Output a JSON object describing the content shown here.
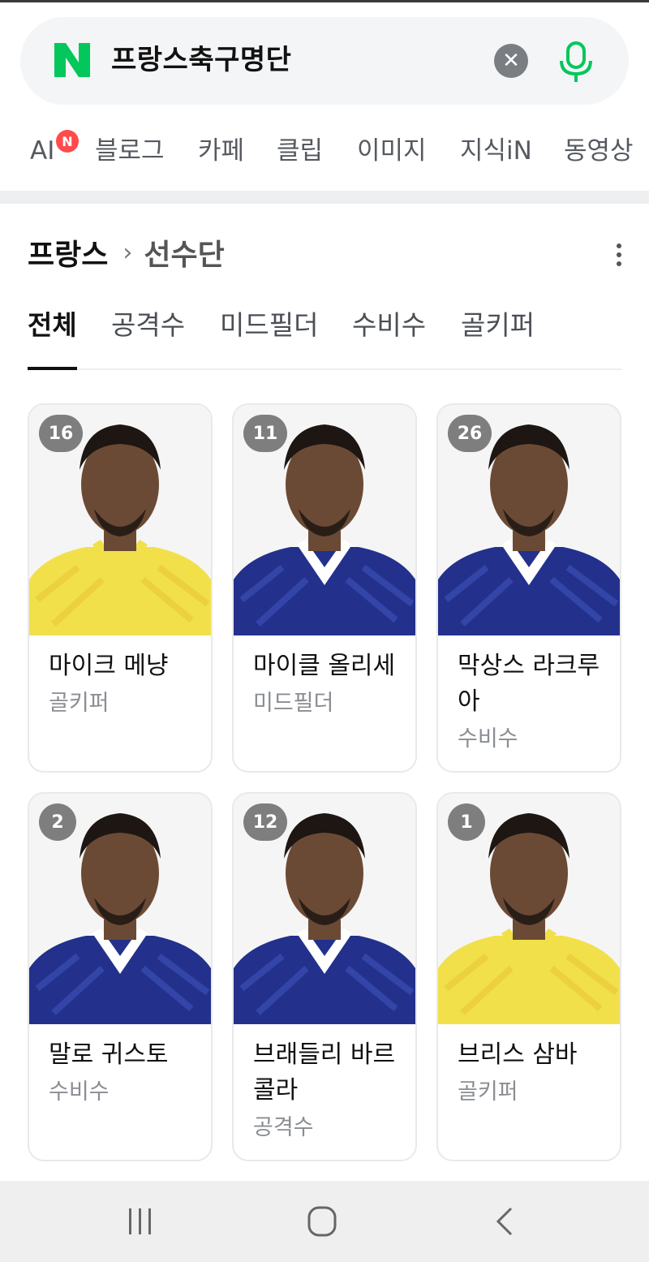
{
  "search": {
    "query": "프랑스축구명단",
    "logo_letter": "N",
    "clear_icon": "close-icon",
    "mic_icon": "mic-icon",
    "accent_color": "#03c75a"
  },
  "tabs": [
    {
      "label": "AI",
      "badge": "N"
    },
    {
      "label": "블로그"
    },
    {
      "label": "카페"
    },
    {
      "label": "클립"
    },
    {
      "label": "이미지"
    },
    {
      "label": "지식iN"
    },
    {
      "label": "동영상"
    }
  ],
  "section": {
    "country": "프랑스",
    "separator": "›",
    "title": "선수단"
  },
  "position_tabs": [
    {
      "label": "전체",
      "active": true
    },
    {
      "label": "공격수",
      "active": false
    },
    {
      "label": "미드필더",
      "active": false
    },
    {
      "label": "수비수",
      "active": false
    },
    {
      "label": "골키퍼",
      "active": false
    }
  ],
  "players": [
    {
      "number": "16",
      "name": "마이크 메냥",
      "position": "골키퍼",
      "jersey": "yellow"
    },
    {
      "number": "11",
      "name": "마이클 올리세",
      "position": "미드필더",
      "jersey": "blue"
    },
    {
      "number": "26",
      "name": "막상스 라크루아",
      "position": "수비수",
      "jersey": "blue"
    },
    {
      "number": "2",
      "name": "말로 귀스토",
      "position": "수비수",
      "jersey": "blue"
    },
    {
      "number": "12",
      "name": "브래들리 바르콜라",
      "position": "공격수",
      "jersey": "blue"
    },
    {
      "number": "1",
      "name": "브리스 삼바",
      "position": "골키퍼",
      "jersey": "yellow"
    }
  ],
  "navbar": {
    "recent_icon": "recent-apps-icon",
    "home_icon": "home-icon",
    "back_icon": "back-icon"
  }
}
